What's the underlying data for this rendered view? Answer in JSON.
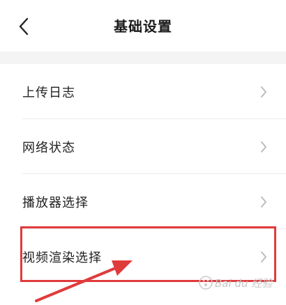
{
  "header": {
    "title": "基础设置",
    "back_icon": "chevron-left-icon"
  },
  "settings": {
    "items": [
      {
        "label": "上传日志",
        "icon": "chevron-right-icon"
      },
      {
        "label": "网络状态",
        "icon": "chevron-right-icon"
      },
      {
        "label": "播放器选择",
        "icon": "chevron-right-icon"
      },
      {
        "label": "视频渲染选择",
        "icon": "chevron-right-icon"
      }
    ]
  },
  "annotation": {
    "box_color": "#e03b3b",
    "arrow_color": "#e03b3b"
  },
  "watermark": {
    "text": "Bai du 经验"
  }
}
